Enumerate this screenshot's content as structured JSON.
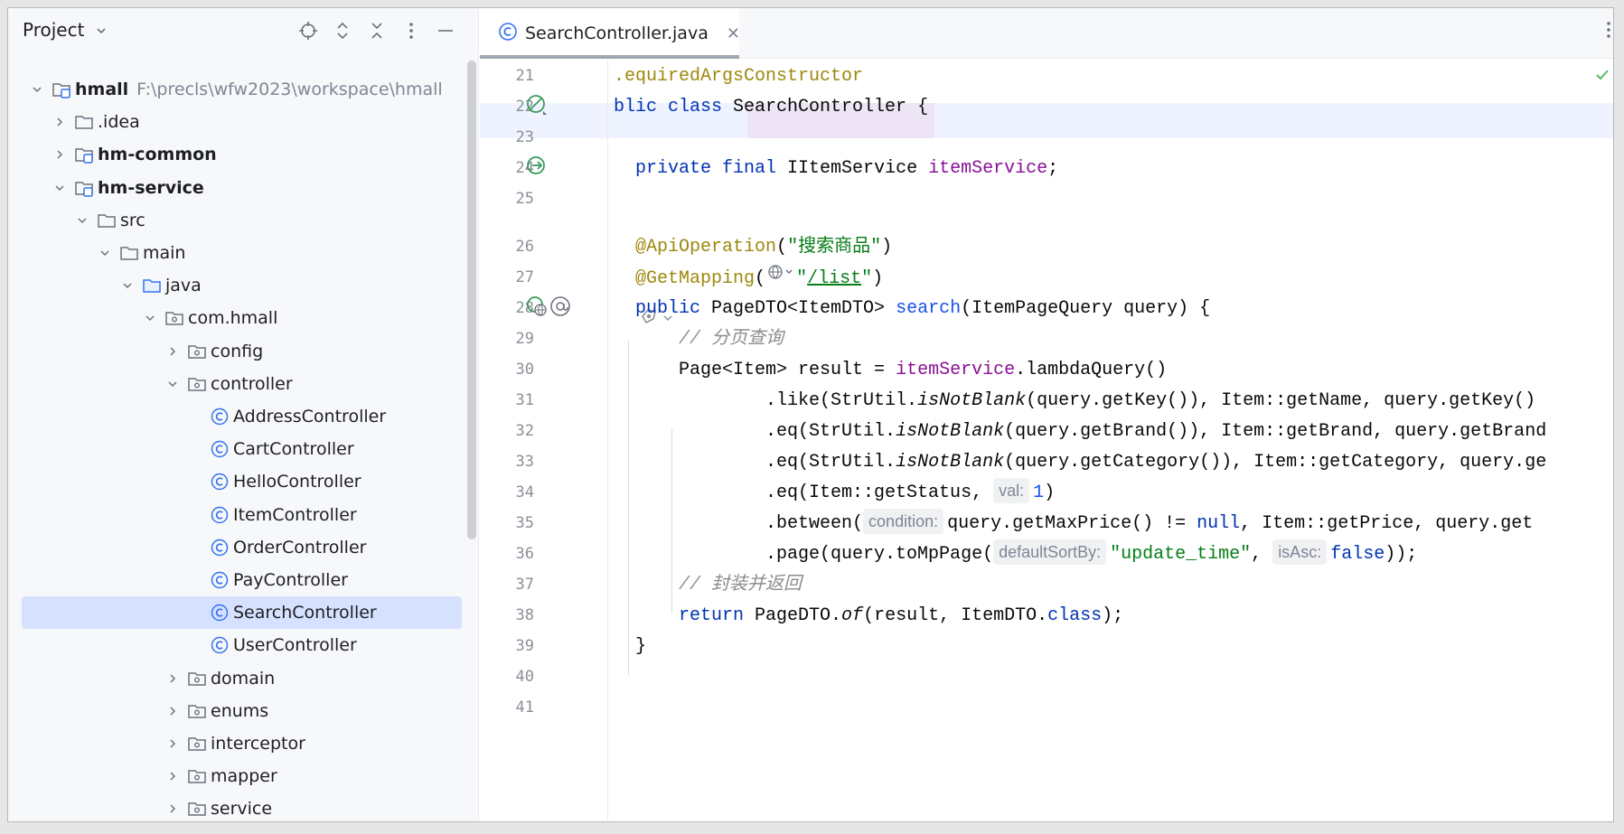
{
  "project_panel": {
    "title": "Project",
    "tree": [
      {
        "label": "hmall",
        "path": "F:\\precls\\wfw2023\\workspace\\hmall",
        "bold": true,
        "icon": "module-folder-icon",
        "expanded": true
      },
      {
        "label": ".idea",
        "icon": "folder-icon",
        "expanded": false
      },
      {
        "label": "hm-common",
        "bold": true,
        "icon": "module-folder-icon",
        "expanded": false
      },
      {
        "label": "hm-service",
        "bold": true,
        "icon": "module-folder-icon",
        "expanded": true
      },
      {
        "label": "src",
        "icon": "folder-icon",
        "expanded": true
      },
      {
        "label": "main",
        "icon": "folder-icon",
        "expanded": true
      },
      {
        "label": "java",
        "icon": "source-folder-icon",
        "expanded": true
      },
      {
        "label": "com.hmall",
        "icon": "package-icon",
        "expanded": true
      },
      {
        "label": "config",
        "icon": "package-icon",
        "expanded": false
      },
      {
        "label": "controller",
        "icon": "package-icon",
        "expanded": true
      },
      {
        "label": "AddressController",
        "icon": "class-icon"
      },
      {
        "label": "CartController",
        "icon": "class-icon"
      },
      {
        "label": "HelloController",
        "icon": "class-icon"
      },
      {
        "label": "ItemController",
        "icon": "class-icon"
      },
      {
        "label": "OrderController",
        "icon": "class-icon"
      },
      {
        "label": "PayController",
        "icon": "class-icon"
      },
      {
        "label": "SearchController",
        "icon": "class-icon",
        "selected": true
      },
      {
        "label": "UserController",
        "icon": "class-icon"
      },
      {
        "label": "domain",
        "icon": "package-icon",
        "expanded": false
      },
      {
        "label": "enums",
        "icon": "package-icon",
        "expanded": false
      },
      {
        "label": "interceptor",
        "icon": "package-icon",
        "expanded": false
      },
      {
        "label": "mapper",
        "icon": "package-icon",
        "expanded": false
      },
      {
        "label": "service",
        "icon": "package-icon",
        "expanded": false
      }
    ]
  },
  "editor": {
    "tab_label": "SearchController.java",
    "tab_close": "✕",
    "ai_hint_icon": "ai-assistant-icon",
    "lines": [
      {
        "n": "21",
        "tokens": [
          [
            "ann",
            ".equiredArgsConstructor"
          ]
        ]
      },
      {
        "n": "22",
        "tokens": [
          [
            "kw",
            "blic class "
          ],
          [
            "",
            "SearchController {"
          ]
        ]
      },
      {
        "n": "23",
        "tokens": []
      },
      {
        "n": "24",
        "tokens": [
          [
            "",
            "  "
          ],
          [
            "kw",
            "private final "
          ],
          [
            "",
            "IItemService "
          ],
          [
            "fld",
            "itemService"
          ],
          [
            "",
            ";"
          ]
        ]
      },
      {
        "n": "25",
        "tokens": []
      },
      {
        "n": "26",
        "tokens": [
          [
            "",
            "  "
          ],
          [
            "ann",
            "@ApiOperation"
          ],
          [
            "",
            "("
          ],
          [
            "str",
            "\"搜索商品\""
          ],
          [
            "",
            ")"
          ]
        ]
      },
      {
        "n": "27",
        "tokens": [
          [
            "",
            "  "
          ],
          [
            "ann",
            "@GetMapping"
          ],
          [
            "",
            "("
          ],
          [
            "globe",
            ""
          ],
          [
            "str",
            "\""
          ],
          [
            "url",
            "/list"
          ],
          [
            "str",
            "\""
          ],
          [
            "",
            ")"
          ]
        ]
      },
      {
        "n": "28",
        "tokens": [
          [
            "",
            "  "
          ],
          [
            "kw",
            "public "
          ],
          [
            "",
            "PageDTO<ItemDTO> "
          ],
          [
            "num",
            "search"
          ],
          [
            "",
            "(ItemPageQuery query) {"
          ]
        ]
      },
      {
        "n": "29",
        "tokens": [
          [
            "",
            "      "
          ],
          [
            "cmt",
            "// 分页查询"
          ]
        ]
      },
      {
        "n": "30",
        "tokens": [
          [
            "",
            "      Page<Item> result = "
          ],
          [
            "fld",
            "itemService"
          ],
          [
            "",
            ".lambdaQuery()"
          ]
        ]
      },
      {
        "n": "31",
        "tokens": [
          [
            "",
            "              .like(StrUtil."
          ],
          [
            "st",
            "isNotBlank"
          ],
          [
            "",
            "(query.getKey()), Item::getName, query.getKey()"
          ]
        ]
      },
      {
        "n": "32",
        "tokens": [
          [
            "",
            "              .eq(StrUtil."
          ],
          [
            "st",
            "isNotBlank"
          ],
          [
            "",
            "(query.getBrand()), Item::getBrand, query.getBrand"
          ]
        ]
      },
      {
        "n": "33",
        "tokens": [
          [
            "",
            "              .eq(StrUtil."
          ],
          [
            "st",
            "isNotBlank"
          ],
          [
            "",
            "(query.getCategory()), Item::getCategory, query.ge"
          ]
        ]
      },
      {
        "n": "34",
        "tokens": [
          [
            "",
            "              .eq(Item::getStatus, "
          ],
          [
            "hint",
            "val:"
          ],
          [
            "num",
            "1"
          ],
          [
            "",
            ")"
          ]
        ]
      },
      {
        "n": "35",
        "tokens": [
          [
            "",
            "              .between("
          ],
          [
            "hint",
            "condition:"
          ],
          [
            "",
            "query.getMaxPrice() != "
          ],
          [
            "kw",
            "null"
          ],
          [
            "",
            ", Item::getPrice, query.get"
          ]
        ]
      },
      {
        "n": "36",
        "tokens": [
          [
            "",
            "              .page(query.toMpPage("
          ],
          [
            "hint",
            "defaultSortBy:"
          ],
          [
            "str",
            "\"update_time\""
          ],
          [
            "",
            ", "
          ],
          [
            "hint",
            "isAsc:"
          ],
          [
            "kw",
            "false"
          ],
          [
            "",
            "));"
          ]
        ]
      },
      {
        "n": "37",
        "tokens": [
          [
            "",
            "      "
          ],
          [
            "cmt",
            "// 封装并返回"
          ]
        ]
      },
      {
        "n": "38",
        "tokens": [
          [
            "",
            "      "
          ],
          [
            "kw",
            "return "
          ],
          [
            "",
            "PageDTO."
          ],
          [
            "st",
            "of"
          ],
          [
            "",
            "(result, ItemDTO."
          ],
          [
            "kw",
            "class"
          ],
          [
            "",
            ");"
          ]
        ]
      },
      {
        "n": "39",
        "tokens": [
          [
            "",
            "  }"
          ]
        ]
      },
      {
        "n": "40",
        "tokens": []
      },
      {
        "n": "41",
        "tokens": []
      }
    ]
  }
}
